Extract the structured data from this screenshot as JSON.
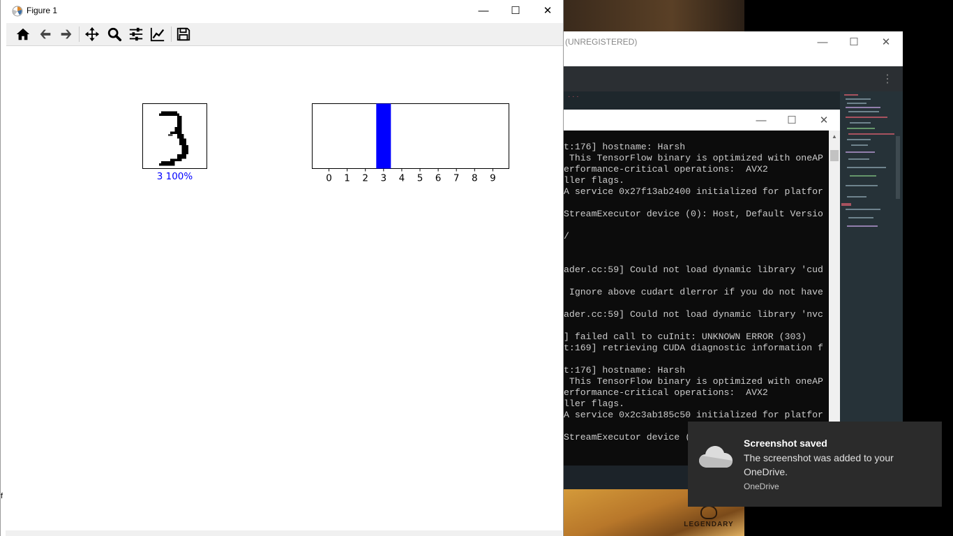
{
  "figure_window": {
    "title": "Figure 1",
    "icons": [
      "home-icon",
      "back-arrow-icon",
      "forward-arrow-icon",
      "pan-icon",
      "zoom-icon",
      "configure-subplots-icon",
      "edit-axes-icon",
      "save-icon"
    ]
  },
  "digit_panel": {
    "predicted_label": "3",
    "caption": "3 100%",
    "caption_color": "#0000ff"
  },
  "chart_data": {
    "type": "bar",
    "categories": [
      "0",
      "1",
      "2",
      "3",
      "4",
      "5",
      "6",
      "7",
      "8",
      "9"
    ],
    "values": [
      0,
      0,
      0,
      1.0,
      0,
      0,
      0,
      0,
      0,
      0
    ],
    "ylim": [
      0,
      1
    ],
    "highlight_color": "#0000ff",
    "default_color": "#777777",
    "grid": false,
    "title": "",
    "xlabel": "",
    "ylabel": ""
  },
  "editor_window": {
    "title": "(UNREGISTERED)"
  },
  "console": {
    "lines": [
      "t:176] hostname: Harsh",
      " This TensorFlow binary is optimized with oneAP",
      "erformance-critical operations:  AVX2",
      "ller flags.",
      "A service 0x27f13ab2400 initialized for platfor",
      "",
      "StreamExecutor device (0): Host, Default Versio",
      "",
      "/",
      "",
      "",
      "ader.cc:59] Could not load dynamic library 'cud",
      "",
      " Ignore above cudart dlerror if you do not have",
      "",
      "ader.cc:59] Could not load dynamic library 'nvc",
      "",
      "] failed call to cuInit: UNKNOWN ERROR (303)",
      "t:169] retrieving CUDA diagnostic information f",
      "",
      "t:176] hostname: Harsh",
      " This TensorFlow binary is optimized with oneAP",
      "erformance-critical operations:  AVX2",
      "ller flags.",
      "A service 0x2c3ab185c50 initialized for platfor",
      "",
      "StreamExecutor device ("
    ]
  },
  "toast": {
    "title": "Screenshot saved",
    "body": "The screenshot was added to your OneDrive.",
    "source": "OneDrive"
  },
  "background": {
    "logo_text": "LEGENDARY"
  },
  "edge_text": {
    "top": "",
    "bottom": "f"
  },
  "window_controls": {
    "minimize": "—",
    "maximize": "☐",
    "close": "✕"
  }
}
